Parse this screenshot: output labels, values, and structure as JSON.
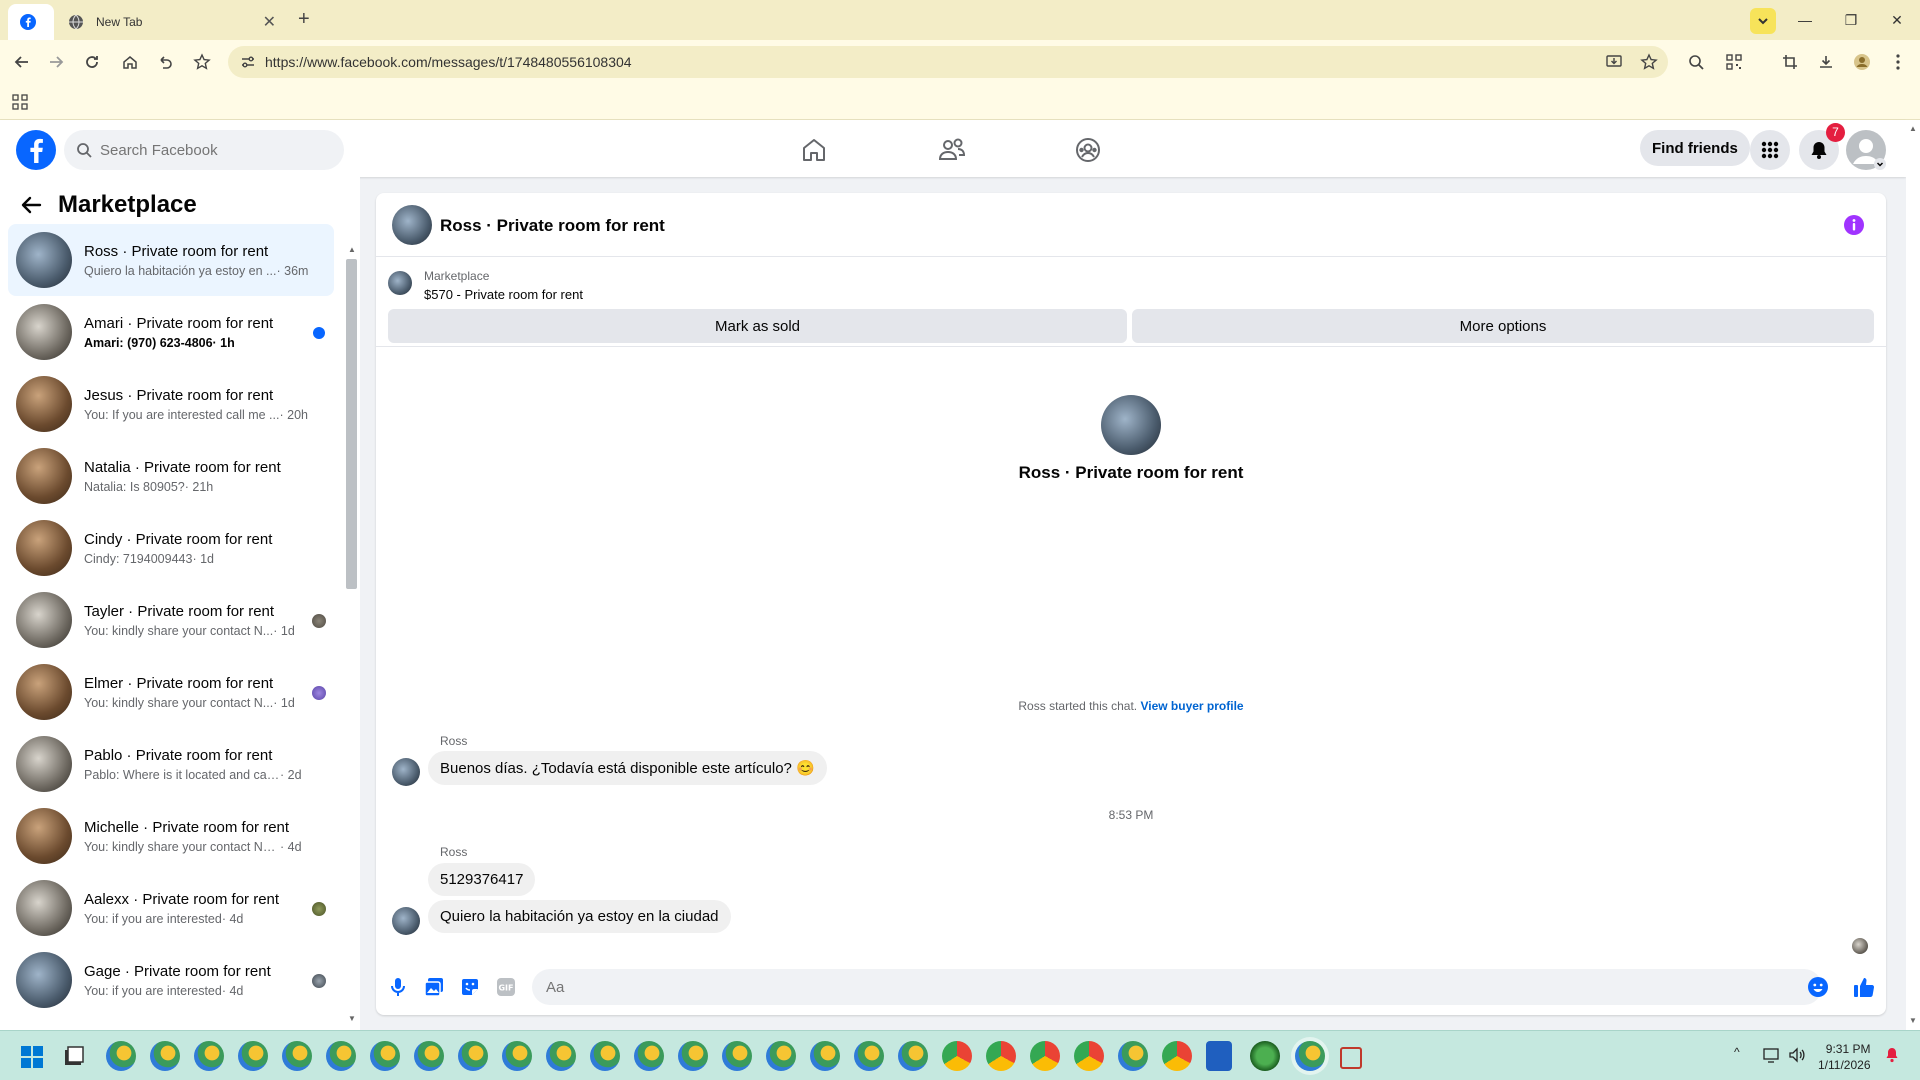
{
  "browser": {
    "tabs": [
      {
        "label": ""
      },
      {
        "label": "New Tab"
      }
    ],
    "url": "https://www.facebook.com/messages/t/1748480556108304"
  },
  "header": {
    "search_placeholder": "Search Facebook",
    "find_friends": "Find friends",
    "notification_count": "7"
  },
  "sidebar": {
    "title": "Marketplace",
    "conversations": [
      {
        "name": "Ross · Private room for rent",
        "preview": "Quiero la habitación ya estoy en ...",
        "time": "· 36m",
        "selected": true
      },
      {
        "name": "Amari · Private room for rent",
        "preview": "Amari: (970) 623-4806",
        "time": "· 1h",
        "unread": true
      },
      {
        "name": "Jesus · Private room for rent",
        "preview": "You: If you are interested call me ...",
        "time": "· 20h"
      },
      {
        "name": "Natalia · Private room for rent",
        "preview": "Natalia: Is 80905?",
        "time": "· 21h"
      },
      {
        "name": "Cindy · Private room for rent",
        "preview": "Cindy: 7194009443",
        "time": "· 1d"
      },
      {
        "name": "Tayler · Private room for rent",
        "preview": "You: kindly share your contact N...",
        "time": "· 1d"
      },
      {
        "name": "Elmer · Private room for rent",
        "preview": "You: kindly share your contact N...",
        "time": "· 1d"
      },
      {
        "name": "Pablo · Private room for rent",
        "preview": "Pablo: Where is it located and can I...",
        "time": "· 2d"
      },
      {
        "name": "Michelle · Private room for rent",
        "preview": "You: kindly share your contact Nu...",
        "time": "· 4d"
      },
      {
        "name": "Aalexx · Private room for rent",
        "preview": "You: if you are interested",
        "time": "· 4d"
      },
      {
        "name": "Gage · Private room for rent",
        "preview": "You: if you are interested",
        "time": "· 4d"
      }
    ]
  },
  "chat": {
    "title": "Ross · Private room for rent",
    "listing_source": "Marketplace",
    "listing_price_title": "$570 - Private room for rent",
    "mark_sold": "Mark as sold",
    "more_options": "More options",
    "center_name": "Ross · Private room for rent",
    "started_text": "Ross started this chat.",
    "view_profile": "View buyer profile",
    "sender1": "Ross",
    "msg1": "Buenos días. ¿Todavía está disponible este artículo? 😊",
    "timestamp": "8:53 PM",
    "sender2": "Ross",
    "msg2": "5129376417",
    "msg3": "Quiero la habitación ya estoy en la ciudad",
    "input_placeholder": "Aa"
  },
  "taskbar": {
    "time": "9:31 PM",
    "date": "1/11/2026"
  },
  "colors": {
    "accent": "#0866ff",
    "messenger_purple": "#a033ff",
    "notification_red": "#e41e3f"
  }
}
